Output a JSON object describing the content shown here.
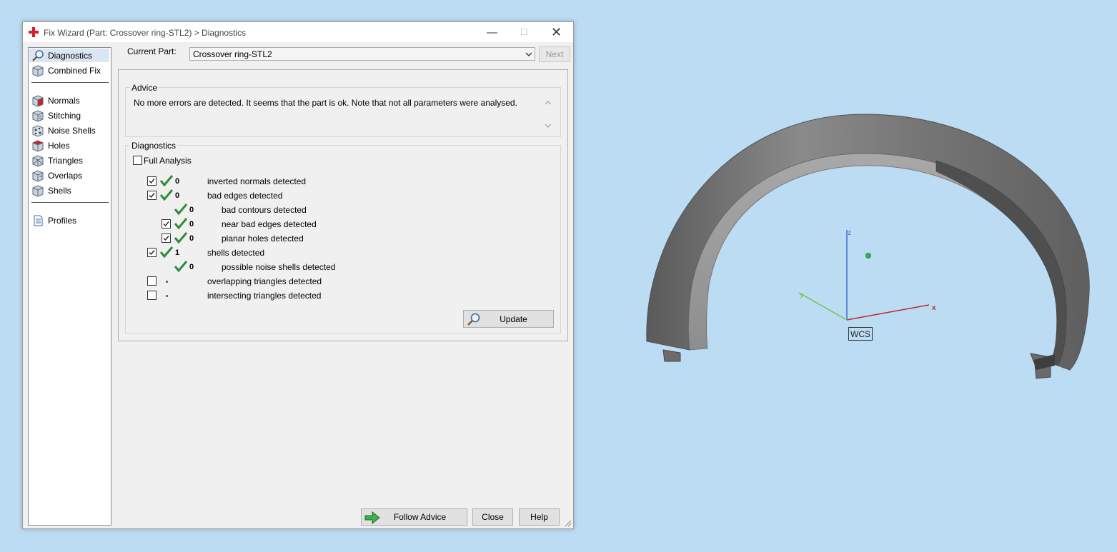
{
  "window": {
    "title": "Fix Wizard (Part: Crossover ring-STL2) > Diagnostics",
    "minimize_glyph": "—",
    "maximize_glyph": "☐",
    "close_glyph": "✕"
  },
  "sidebar": {
    "items": [
      {
        "label": "Diagnostics",
        "icon": "magnifier-icon",
        "selected": true
      },
      {
        "label": "Combined Fix",
        "icon": "cube-icon"
      },
      {
        "label": "Normals",
        "icon": "normals-cube-icon"
      },
      {
        "label": "Stitching",
        "icon": "stitching-cube-icon"
      },
      {
        "label": "Noise Shells",
        "icon": "noise-shells-icon"
      },
      {
        "label": "Holes",
        "icon": "holes-cube-icon"
      },
      {
        "label": "Triangles",
        "icon": "triangles-cube-icon"
      },
      {
        "label": "Overlaps",
        "icon": "overlaps-cube-icon"
      },
      {
        "label": "Shells",
        "icon": "shells-cube-icon"
      },
      {
        "label": "Profiles",
        "icon": "document-icon"
      }
    ]
  },
  "current_part": {
    "label": "Current Part:",
    "value": "Crossover ring-STL2",
    "next_label": "Next"
  },
  "advice": {
    "title": "Advice",
    "text": "No more errors are detected. It seems that the part is ok. Note that not all parameters were analysed."
  },
  "diagnostics": {
    "title": "Diagnostics",
    "full_analysis_label": "Full Analysis",
    "full_analysis_checked": false,
    "rows": [
      {
        "count": "0",
        "label": "inverted normals detected",
        "checked": true,
        "status": "ok"
      },
      {
        "count": "0",
        "label": "bad edges detected",
        "checked": true,
        "status": "ok"
      },
      {
        "count": "0",
        "label": "bad contours detected",
        "status": "ok"
      },
      {
        "count": "0",
        "label": "near bad edges detected",
        "checked": true,
        "status": "ok"
      },
      {
        "count": "0",
        "label": "planar holes detected",
        "checked": true,
        "status": "ok"
      },
      {
        "count": "1",
        "label": "shells detected",
        "checked": true,
        "status": "ok"
      },
      {
        "count": "0",
        "label": "possible noise shells detected",
        "status": "ok"
      },
      {
        "count": "",
        "label": "overlapping triangles detected",
        "checked": false,
        "status": "not-analysed"
      },
      {
        "count": "",
        "label": "intersecting triangles detected",
        "checked": false,
        "status": "not-analysed"
      }
    ],
    "update_label": "Update"
  },
  "footer": {
    "follow_advice_label": "Follow Advice",
    "close_label": "Close",
    "help_label": "Help"
  },
  "viewport": {
    "background": "#bcdcf4",
    "wcs_label": "WCS",
    "axes": {
      "x": "x",
      "y": "y",
      "z": "z"
    },
    "axis_colors": {
      "x": "#c0282a",
      "y": "#6cc64a",
      "z": "#3d6fd0"
    },
    "model_color": "#7d7d7d"
  }
}
